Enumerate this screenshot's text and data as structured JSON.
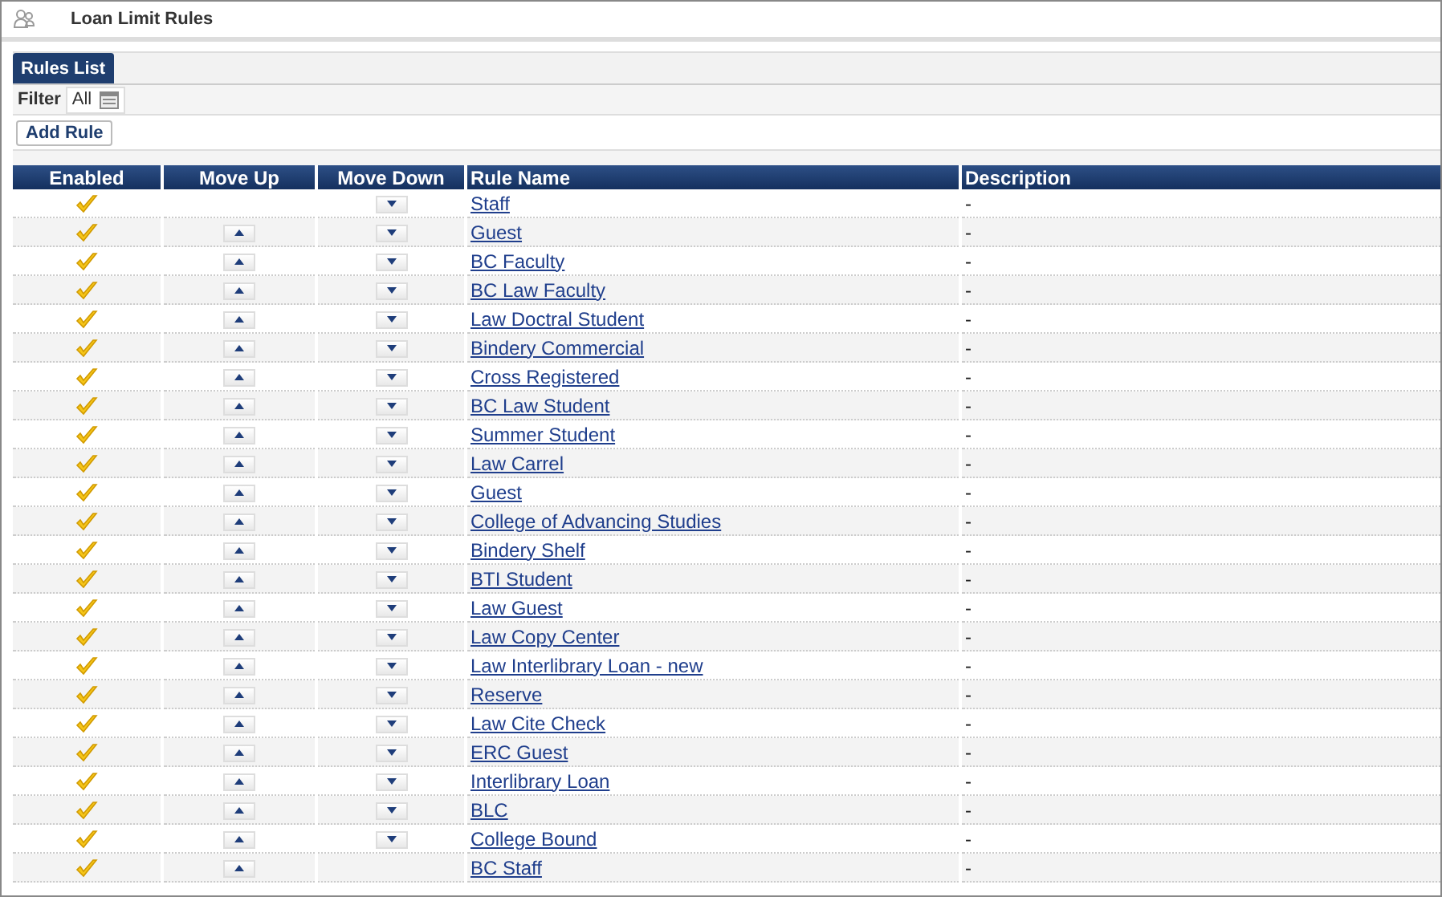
{
  "window": {
    "title": "Loan Limit Rules"
  },
  "tabs": [
    {
      "label": "Rules List",
      "selected": true
    }
  ],
  "filter": {
    "label": "Filter",
    "value": "All"
  },
  "add_button": "Add Rule",
  "table": {
    "columns": [
      "Enabled",
      "Move Up",
      "Move Down",
      "Rule Name",
      "Description"
    ],
    "rows": [
      {
        "enabled": true,
        "move_up": false,
        "move_down": true,
        "name": "Staff",
        "description": "-"
      },
      {
        "enabled": true,
        "move_up": true,
        "move_down": true,
        "name": "Guest",
        "description": "-"
      },
      {
        "enabled": true,
        "move_up": true,
        "move_down": true,
        "name": "BC Faculty",
        "description": "-"
      },
      {
        "enabled": true,
        "move_up": true,
        "move_down": true,
        "name": "BC Law Faculty",
        "description": "-"
      },
      {
        "enabled": true,
        "move_up": true,
        "move_down": true,
        "name": "Law Doctral Student",
        "description": "-"
      },
      {
        "enabled": true,
        "move_up": true,
        "move_down": true,
        "name": "Bindery Commercial",
        "description": "-"
      },
      {
        "enabled": true,
        "move_up": true,
        "move_down": true,
        "name": "Cross Registered",
        "description": "-"
      },
      {
        "enabled": true,
        "move_up": true,
        "move_down": true,
        "name": "BC Law Student",
        "description": "-"
      },
      {
        "enabled": true,
        "move_up": true,
        "move_down": true,
        "name": "Summer Student",
        "description": "-"
      },
      {
        "enabled": true,
        "move_up": true,
        "move_down": true,
        "name": "Law Carrel",
        "description": "-"
      },
      {
        "enabled": true,
        "move_up": true,
        "move_down": true,
        "name": "Guest",
        "description": "-"
      },
      {
        "enabled": true,
        "move_up": true,
        "move_down": true,
        "name": "College of Advancing Studies",
        "description": "-"
      },
      {
        "enabled": true,
        "move_up": true,
        "move_down": true,
        "name": "Bindery Shelf",
        "description": "-"
      },
      {
        "enabled": true,
        "move_up": true,
        "move_down": true,
        "name": "BTI Student",
        "description": "-"
      },
      {
        "enabled": true,
        "move_up": true,
        "move_down": true,
        "name": "Law Guest",
        "description": "-"
      },
      {
        "enabled": true,
        "move_up": true,
        "move_down": true,
        "name": "Law Copy Center",
        "description": "-"
      },
      {
        "enabled": true,
        "move_up": true,
        "move_down": true,
        "name": "Law Interlibrary Loan - new",
        "description": "-"
      },
      {
        "enabled": true,
        "move_up": true,
        "move_down": true,
        "name": "Reserve",
        "description": "-"
      },
      {
        "enabled": true,
        "move_up": true,
        "move_down": true,
        "name": "Law Cite Check",
        "description": "-"
      },
      {
        "enabled": true,
        "move_up": true,
        "move_down": true,
        "name": "ERC Guest",
        "description": "-"
      },
      {
        "enabled": true,
        "move_up": true,
        "move_down": true,
        "name": "Interlibrary Loan",
        "description": "-"
      },
      {
        "enabled": true,
        "move_up": true,
        "move_down": true,
        "name": "BLC",
        "description": "-"
      },
      {
        "enabled": true,
        "move_up": true,
        "move_down": true,
        "name": "College Bound",
        "description": "-"
      },
      {
        "enabled": true,
        "move_up": true,
        "move_down": false,
        "name": "BC Staff",
        "description": "-"
      }
    ]
  }
}
